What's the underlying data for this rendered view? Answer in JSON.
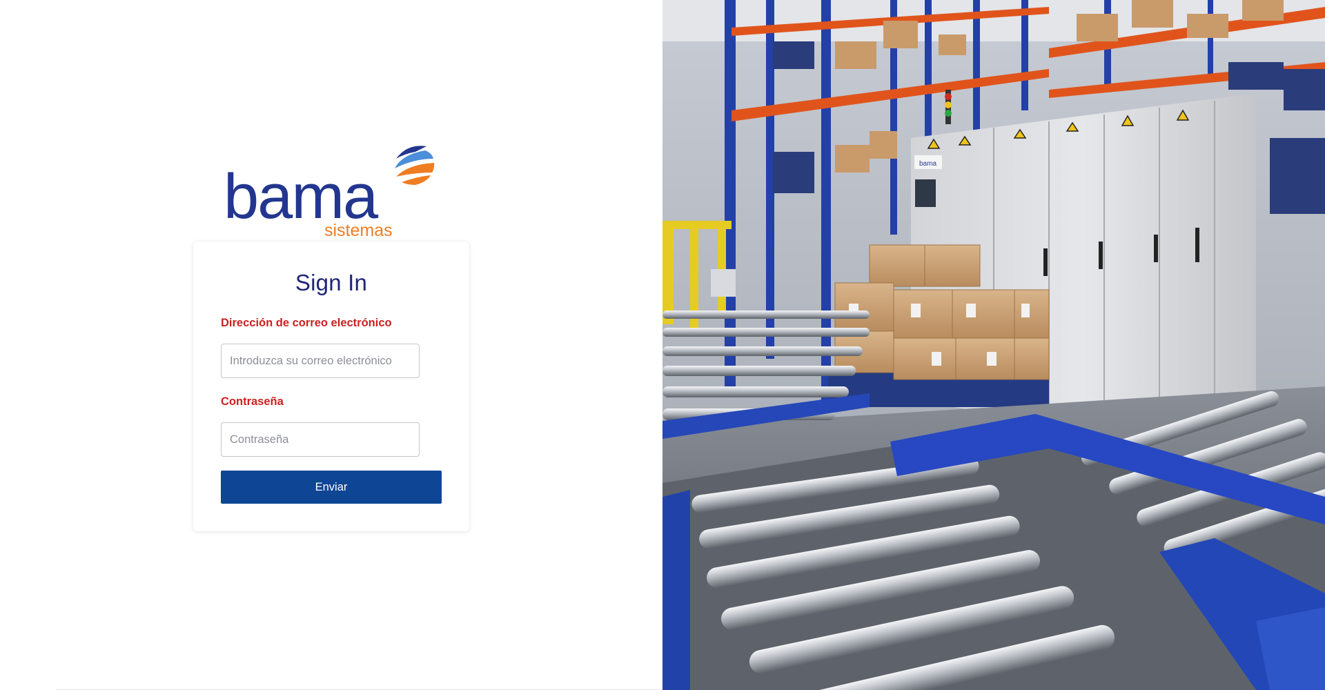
{
  "brand": {
    "logo_text": "bama",
    "logo_subtext": "sistemas",
    "primary_color": "#23368f",
    "accent_color": "#ef7d22"
  },
  "login": {
    "title": "Sign In",
    "email_label": "Dirección de correo electrónico",
    "email_placeholder": "Introduzca su correo electrónico",
    "email_value": "",
    "password_label": "Contraseña",
    "password_placeholder": "Contraseña",
    "password_value": "",
    "submit_label": "Enviar",
    "label_color": "#cc2020",
    "button_color": "#0f4595"
  },
  "photo": {
    "cabinet_label": "bama"
  }
}
